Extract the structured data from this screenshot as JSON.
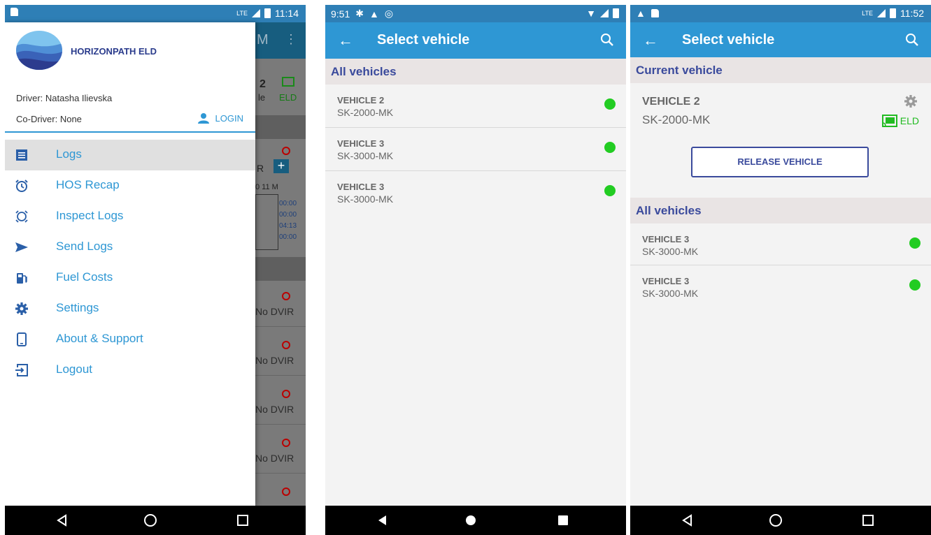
{
  "screen1": {
    "status": {
      "lte": "LTE",
      "time": "11:14"
    },
    "brand": "HORIZONPATH ELD",
    "driver": "Driver: Natasha Ilievska",
    "codriver": "Co-Driver: None",
    "login_label": "LOGIN",
    "menu": [
      {
        "label": "Logs",
        "icon": "logs-icon",
        "active": true
      },
      {
        "label": "HOS Recap",
        "icon": "alarm-clock-icon"
      },
      {
        "label": "Inspect Logs",
        "icon": "inspect-icon"
      },
      {
        "label": "Send Logs",
        "icon": "send-icon"
      },
      {
        "label": "Fuel Costs",
        "icon": "fuel-pump-icon"
      },
      {
        "label": "Settings",
        "icon": "gear-icon"
      },
      {
        "label": "About & Support",
        "icon": "phone-icon"
      },
      {
        "label": "Logout",
        "icon": "logout-icon"
      }
    ],
    "underlay": {
      "title_fragment": "M",
      "vehicle_number": "2",
      "vehicle_suffix": "le",
      "eld_label": "ELD",
      "r_label": "R",
      "clock_label": "0 11 M",
      "times": [
        "00:00",
        "00:00",
        "04:13",
        "00:00"
      ],
      "dvir_label": "No DVIR"
    }
  },
  "screen2": {
    "status": {
      "time": "9:51"
    },
    "title": "Select vehicle",
    "section": "All vehicles",
    "vehicles": [
      {
        "name": "VEHICLE 2",
        "plate": "SK-2000-MK"
      },
      {
        "name": "VEHICLE 3",
        "plate": "SK-3000-MK"
      },
      {
        "name": "VEHICLE 3",
        "plate": "SK-3000-MK"
      }
    ]
  },
  "screen3": {
    "status": {
      "lte": "LTE",
      "time": "11:52"
    },
    "title": "Select vehicle",
    "current_section": "Current vehicle",
    "current": {
      "name": "VEHICLE 2",
      "plate": "SK-2000-MK",
      "eld_label": "ELD"
    },
    "release_label": "RELEASE VEHICLE",
    "all_section": "All vehicles",
    "vehicles": [
      {
        "name": "VEHICLE 3",
        "plate": "SK-3000-MK"
      },
      {
        "name": "VEHICLE 3",
        "plate": "SK-3000-MK"
      }
    ]
  },
  "colors": {
    "accent": "#2e97d4",
    "statusbar": "#2e7fb6",
    "heading": "#3a4a9c",
    "online": "#22cc22"
  }
}
